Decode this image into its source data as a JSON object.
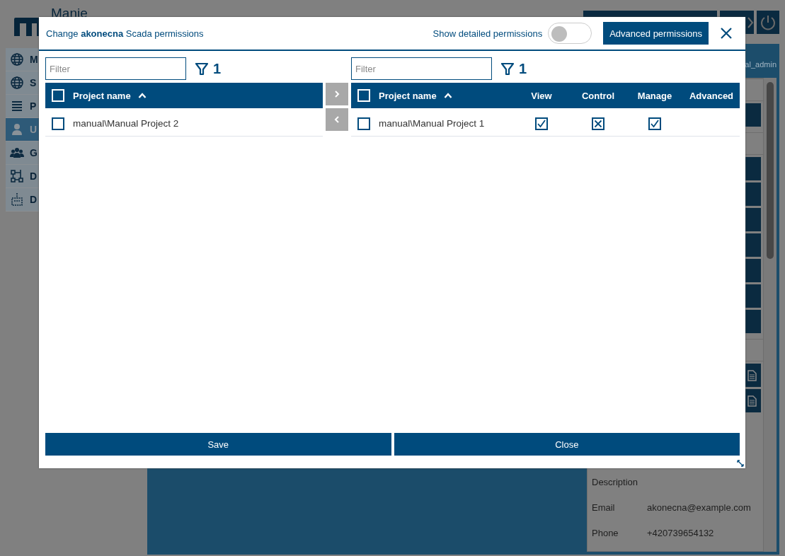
{
  "background": {
    "app_title": "Manie",
    "sidebar": [
      {
        "label": "M",
        "kind": "globe",
        "selected": false
      },
      {
        "label": "S",
        "kind": "globe",
        "selected": false
      },
      {
        "label": "P",
        "kind": "list",
        "selected": false
      },
      {
        "label": "U",
        "kind": "user",
        "selected": true
      },
      {
        "label": "G",
        "kind": "group",
        "selected": false
      },
      {
        "label": "D",
        "kind": "diagram",
        "selected": false
      },
      {
        "label": "D",
        "kind": "device",
        "selected": false
      }
    ],
    "user_label": "al_admin",
    "details": [
      {
        "label": "Description"
      },
      {
        "label": "Email",
        "value": "akonecna@example.com"
      },
      {
        "label": "Phone",
        "value": "+420739654132"
      }
    ]
  },
  "dialog": {
    "title": "Change **akonecna** Scada permissions",
    "toggle": {
      "label": "Show detailed permissions",
      "on": false
    },
    "advanced_button": "Advanced permissions",
    "left": {
      "filter": {
        "placeholder": "Filter"
      },
      "filter_count": "1",
      "header_checked": false,
      "columns": [
        {
          "label": "Project name",
          "sorted": true
        }
      ],
      "rows": [
        {
          "name": "manual\\Manual Project 2",
          "checked": false
        }
      ]
    },
    "right": {
      "filter": {
        "placeholder": "Filter"
      },
      "filter_count": "1",
      "header_checked": false,
      "columns": [
        {
          "label": "Project name",
          "sorted": true
        },
        {
          "label": "View",
          "sorted": false
        },
        {
          "label": "Control",
          "sorted": false
        },
        {
          "label": "Manage",
          "sorted": false
        },
        {
          "label": "Advanced",
          "sorted": false
        }
      ],
      "rows": [
        {
          "name": "manual\\Manual Project 1",
          "checked": false,
          "permissions": [
            {
              "checked": true
            },
            {
              "denied": true
            },
            {
              "checked": true
            }
          ]
        }
      ]
    },
    "buttons": [
      "Save",
      "Close"
    ]
  }
}
